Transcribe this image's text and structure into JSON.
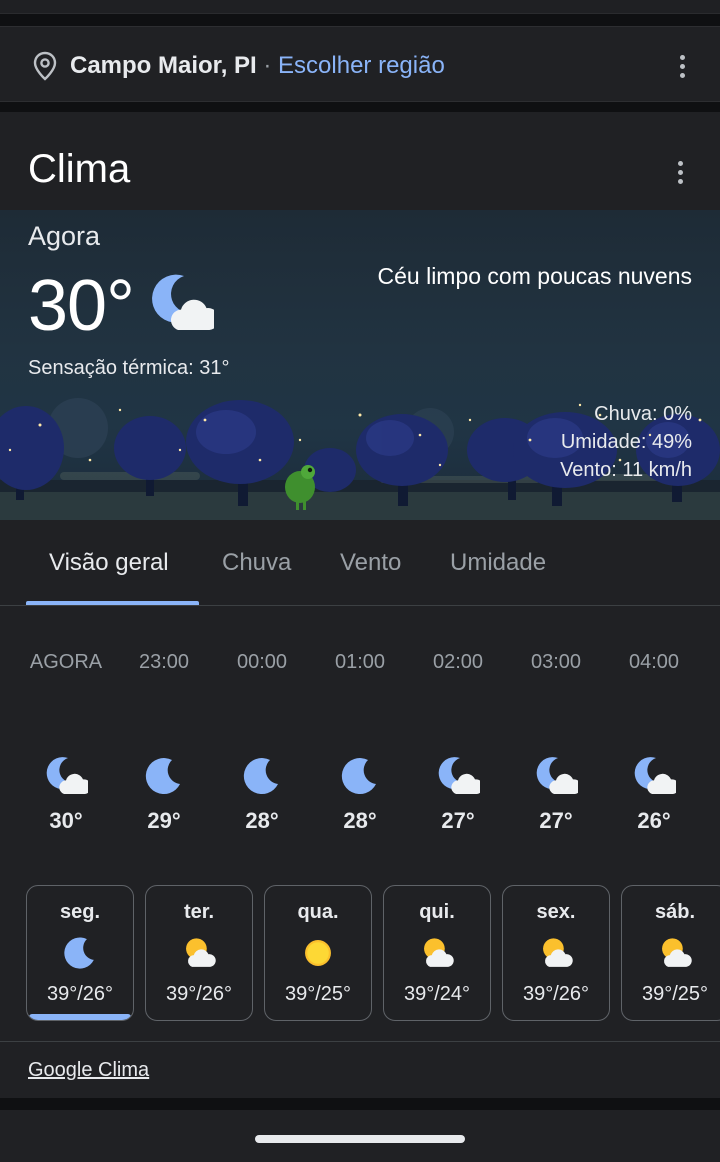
{
  "location": {
    "city": "Campo Maior, PI",
    "separator": " · ",
    "choose_region": "Escolher região"
  },
  "card": {
    "title": "Clima"
  },
  "now": {
    "label": "Agora",
    "temperature": "30°",
    "feels_like": "Sensação térmica: 31°",
    "condition": "Céu limpo com poucas nuvens",
    "rain": "Chuva: 0%",
    "humidity": "Umidade: 49%",
    "wind": "Vento: 11 km/h",
    "icon": "moon-cloud-icon"
  },
  "tabs": [
    {
      "label": "Visão geral",
      "active": true
    },
    {
      "label": "Chuva",
      "active": false
    },
    {
      "label": "Vento",
      "active": false
    },
    {
      "label": "Umidade",
      "active": false
    }
  ],
  "hourly": [
    {
      "time": "AGORA",
      "temp": "30°",
      "icon": "moon-cloud"
    },
    {
      "time": "23:00",
      "temp": "29°",
      "icon": "moon"
    },
    {
      "time": "00:00",
      "temp": "28°",
      "icon": "moon"
    },
    {
      "time": "01:00",
      "temp": "28°",
      "icon": "moon"
    },
    {
      "time": "02:00",
      "temp": "27°",
      "icon": "moon-cloud"
    },
    {
      "time": "03:00",
      "temp": "27°",
      "icon": "moon-cloud"
    },
    {
      "time": "04:00",
      "temp": "26°",
      "icon": "moon-cloud"
    }
  ],
  "daily": [
    {
      "day": "seg.",
      "temps": "39°/26°",
      "icon": "moon",
      "selected": true
    },
    {
      "day": "ter.",
      "temps": "39°/26°",
      "icon": "sun-cloud",
      "selected": false
    },
    {
      "day": "qua.",
      "temps": "39°/25°",
      "icon": "sun",
      "selected": false
    },
    {
      "day": "qui.",
      "temps": "39°/24°",
      "icon": "sun-cloud",
      "selected": false
    },
    {
      "day": "sex.",
      "temps": "39°/26°",
      "icon": "sun-cloud",
      "selected": false
    },
    {
      "day": "sáb.",
      "temps": "39°/25°",
      "icon": "sun-cloud",
      "selected": false
    }
  ],
  "footer": {
    "link": "Google Clima"
  },
  "colors": {
    "accent": "#8ab4f8",
    "card_bg": "#202124",
    "moon": "#8ab4f8",
    "sun": "#fbc02d"
  }
}
